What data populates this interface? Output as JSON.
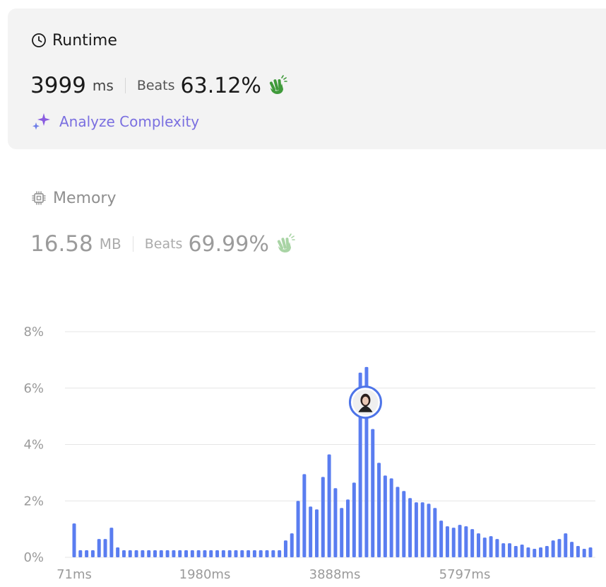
{
  "runtime": {
    "label": "Runtime",
    "value": "3999",
    "unit": "ms",
    "beats_label": "Beats",
    "beats_value": "63.12%",
    "analyze_label": "Analyze Complexity"
  },
  "memory": {
    "label": "Memory",
    "value": "16.58",
    "unit": "MB",
    "beats_label": "Beats",
    "beats_value": "69.99%"
  },
  "icons": {
    "runtime": "clock-icon",
    "memory": "chip-icon",
    "beats": "clapping-hands-icon",
    "analyze": "sparkles-icon",
    "marker": "user-avatar"
  },
  "colors": {
    "bar": "#5a7df0",
    "clap_green": "#3f9a3a",
    "clap_faded": "#a9d4a5",
    "analyze_text": "#7a6fe0",
    "sparkle": "#8a5ce0"
  },
  "chart_data": {
    "type": "bar",
    "x_ticks": [
      "71ms",
      "1980ms",
      "3888ms",
      "5797ms"
    ],
    "y_ticks": [
      "0%",
      "2%",
      "4%",
      "6%",
      "8%"
    ],
    "ylim": [
      0,
      8
    ],
    "values": [
      1.2,
      0.25,
      0.25,
      0.25,
      0.65,
      0.65,
      1.05,
      0.35,
      0.25,
      0.25,
      0.25,
      0.25,
      0.25,
      0.25,
      0.25,
      0.25,
      0.25,
      0.25,
      0.25,
      0.25,
      0.25,
      0.25,
      0.25,
      0.25,
      0.25,
      0.25,
      0.25,
      0.25,
      0.25,
      0.25,
      0.25,
      0.25,
      0.25,
      0.25,
      0.6,
      0.85,
      2.0,
      2.95,
      1.8,
      1.7,
      2.85,
      3.65,
      2.45,
      1.75,
      2.05,
      2.65,
      6.55,
      6.75,
      4.55,
      3.35,
      2.9,
      2.8,
      2.5,
      2.35,
      2.1,
      1.95,
      1.95,
      1.9,
      1.75,
      1.3,
      1.1,
      1.05,
      1.15,
      1.1,
      1.0,
      0.85,
      0.7,
      0.75,
      0.65,
      0.5,
      0.5,
      0.4,
      0.45,
      0.35,
      0.3,
      0.35,
      0.4,
      0.6,
      0.65,
      0.85,
      0.55,
      0.4,
      0.3,
      0.35
    ],
    "marker_index": 47,
    "marker_value": 5.5,
    "grid": true
  }
}
